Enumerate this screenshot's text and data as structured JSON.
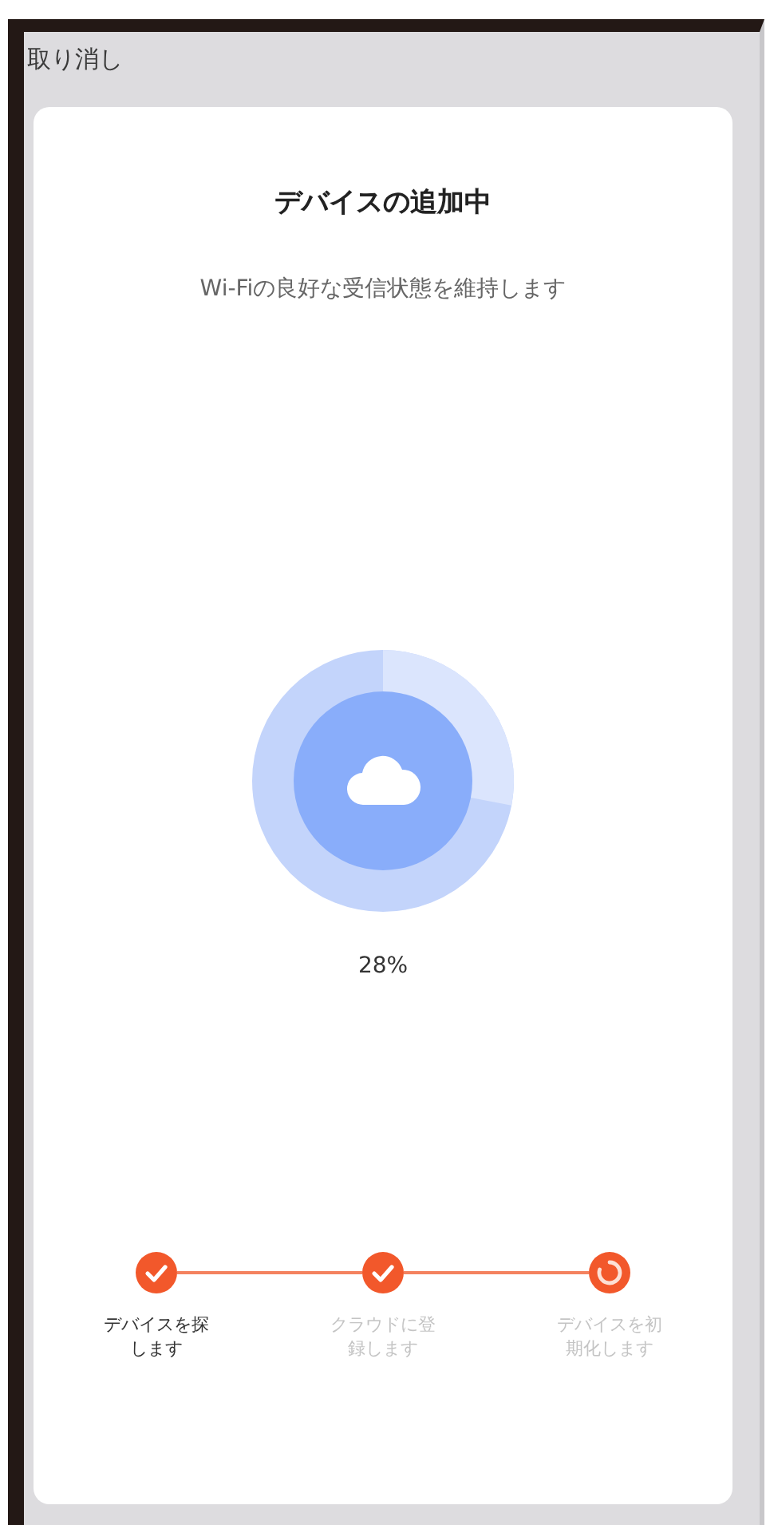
{
  "cancel_label": "取り消し",
  "title": "デバイスの追加中",
  "subtitle": "Wi-Fiの良好な受信状態を維持します",
  "progress": {
    "level": 0.28,
    "reading": "28%"
  },
  "steps": [
    {
      "label": "デバイスを探します",
      "kind": "done",
      "dimmed": false
    },
    {
      "label": "クラウドに登録します",
      "kind": "done",
      "dimmed": true
    },
    {
      "label": "デバイスを初期化します",
      "kind": "active",
      "dimmed": true
    }
  ]
}
